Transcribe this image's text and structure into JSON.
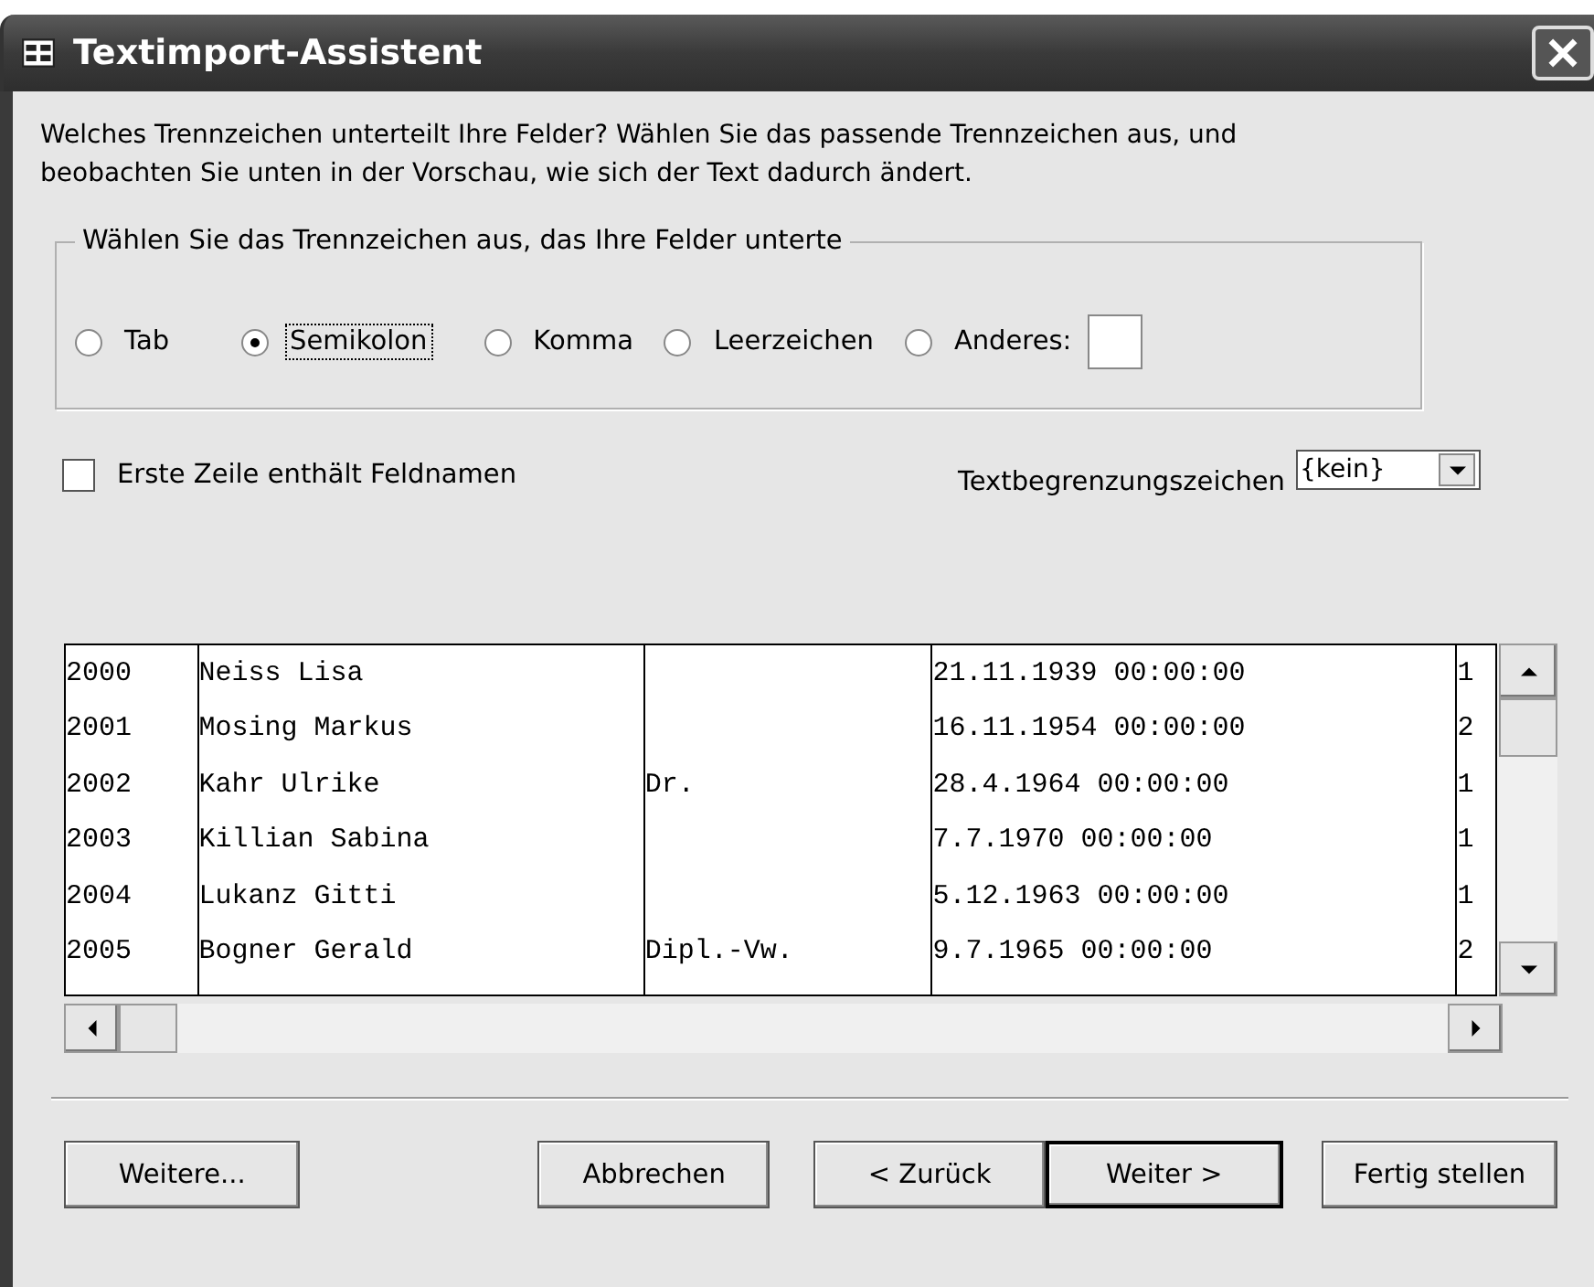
{
  "window": {
    "title": "Textimport-Assistent"
  },
  "intro": "Welches Trennzeichen unterteilt Ihre Felder?  Wählen Sie das passende Trennzeichen aus, und beobachten Sie unten in der Vorschau, wie sich der Text dadurch ändert.",
  "delimiter_group": {
    "legend": "Wählen Sie das Trennzeichen aus, das Ihre Felder unterte",
    "options": [
      {
        "label": "Tab",
        "selected": false,
        "focused": false
      },
      {
        "label": "Semikolon",
        "selected": true,
        "focused": true
      },
      {
        "label": "Komma",
        "selected": false,
        "focused": false
      },
      {
        "label": "Leerzeichen",
        "selected": false,
        "focused": false
      },
      {
        "label": "Anderes:",
        "selected": false,
        "focused": false,
        "kind": "with_field"
      }
    ]
  },
  "first_row_names": {
    "label": "Erste Zeile enthält Feldnamen",
    "checked": false
  },
  "text_qualifier": {
    "label": "Textbegrenzungszeichen",
    "value": "{kein}"
  },
  "preview": {
    "rows": [
      [
        "2000",
        "Neiss Lisa",
        "",
        "21.11.1939 00:00:00",
        "1"
      ],
      [
        "2001",
        "Mosing Markus",
        "",
        "16.11.1954 00:00:00",
        "2"
      ],
      [
        "2002",
        "Kahr Ulrike",
        "Dr.",
        "28.4.1964 00:00:00",
        "1"
      ],
      [
        "2003",
        "Killian Sabina",
        "",
        "7.7.1970 00:00:00",
        "1"
      ],
      [
        "2004",
        "Lukanz Gitti",
        "",
        "5.12.1963 00:00:00",
        "1"
      ],
      [
        "2005",
        "Bogner Gerald",
        "Dipl.-Vw.",
        "9.7.1965 00:00:00",
        "2"
      ]
    ]
  },
  "buttons": [
    {
      "label": "Weitere...",
      "default": false
    },
    {
      "label": "Abbrechen",
      "default": false
    },
    {
      "label": "< Zurück",
      "default": false
    },
    {
      "label": "Weiter >",
      "default": true
    },
    {
      "label": "Fertig stellen",
      "default": false
    }
  ]
}
